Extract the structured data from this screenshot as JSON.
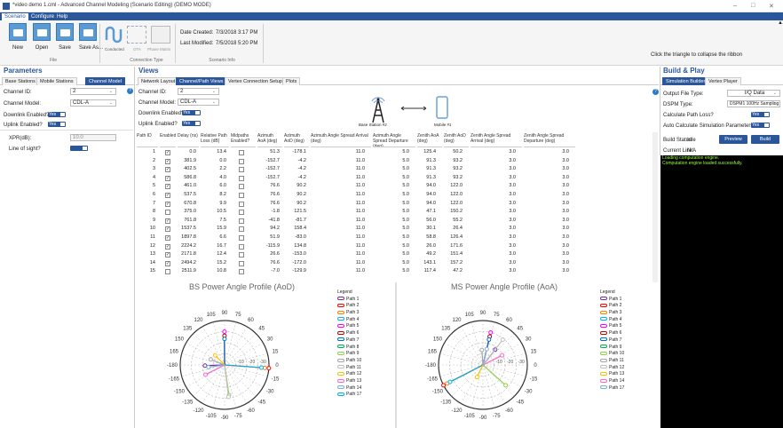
{
  "window": {
    "title": "*video demo 1.cml - Advanced Channel Modeling (Scenario Editing) (DEMO MODE)",
    "min": "–",
    "restore": "□",
    "close": "✕"
  },
  "menu": {
    "tabs": [
      "Scenario",
      "Configure",
      "Help"
    ]
  },
  "ribbon": {
    "file_buttons": [
      "New",
      "Open",
      "Save",
      "Save As..."
    ],
    "file_group": "File",
    "conn_buttons": [
      "Conducted",
      "OTA",
      "Phase Matrix"
    ],
    "conn_group": "Connection Type",
    "date_created_label": "Date Created:",
    "date_created": "7/3/2018 3:17 PM",
    "last_modified_label": "Last Modified:",
    "last_modified": "7/5/2018 5:20 PM",
    "scenario_group": "Scenario Info",
    "collapse_hint": "Click the triangle to collapse the ribbon"
  },
  "parameters": {
    "title": "Parameters",
    "tabs": [
      "Base Stations",
      "Mobile Stations",
      "Channel Model"
    ],
    "channel_id_label": "Channel ID:",
    "channel_id": "2",
    "channel_model_label": "Channel Model:",
    "channel_model": "CDL-A",
    "downlink_label": "Downlink Enabled?",
    "uplink_label": "Uplink Enabled?",
    "toggle_yes": "Yes",
    "xpr_label": "XPR(dB):",
    "xpr_value": "10.0",
    "los_label": "Line of sight?"
  },
  "views": {
    "title": "Views",
    "tabs": [
      "Network Layout",
      "Channel/Path Views",
      "Vertex Connection Setup",
      "Plots"
    ],
    "channel_id_label": "Channel ID:",
    "channel_id": "2",
    "channel_model_label": "Channel Model:",
    "channel_model": "CDL-A",
    "downlink_label": "Downlink Enabled?",
    "uplink_label": "Uplink Enabled?",
    "toggle_yes": "Yes",
    "base_station_label": "Base Station #2",
    "mobile_label": "Mobile #1"
  },
  "table": {
    "headers": [
      "Path ID",
      "Enabled?",
      "Delay (ns)",
      "Relative Path Loss (dB)",
      "Midpaths Enabled?",
      "Azimuth AoA (deg)",
      "Azimuth AoD (deg)",
      "Azimuth Angle Spread Arrival (deg)",
      "Azimuth Angle Spread Departure (deg)",
      "Zenith AoA (deg)",
      "Zenith AoD (deg)",
      "Zenith Angle Spread Arrival (deg)",
      "Zenith Angle Spread Departure (deg)"
    ],
    "rows": [
      [
        "1",
        true,
        "0.0",
        "13.4",
        false,
        "51.3",
        "-178.1",
        "11.0",
        "5.0",
        "125.4",
        "50.2",
        "3.0",
        "3.0"
      ],
      [
        "2",
        true,
        "381.9",
        "0.0",
        false,
        "-152.7",
        "-4.2",
        "11.0",
        "5.0",
        "91.3",
        "93.2",
        "3.0",
        "3.0"
      ],
      [
        "3",
        true,
        "402.5",
        "2.2",
        false,
        "-152.7",
        "-4.2",
        "11.0",
        "5.0",
        "91.3",
        "93.2",
        "3.0",
        "3.0"
      ],
      [
        "4",
        true,
        "586.8",
        "4.0",
        false,
        "-152.7",
        "-4.2",
        "11.0",
        "5.0",
        "91.3",
        "93.2",
        "3.0",
        "3.0"
      ],
      [
        "5",
        true,
        "461.0",
        "6.0",
        false,
        "76.6",
        "90.2",
        "11.0",
        "5.0",
        "94.0",
        "122.0",
        "3.0",
        "3.0"
      ],
      [
        "6",
        true,
        "537.5",
        "8.2",
        false,
        "76.6",
        "90.2",
        "11.0",
        "5.0",
        "94.0",
        "122.0",
        "3.0",
        "3.0"
      ],
      [
        "7",
        true,
        "670.8",
        "9.9",
        false,
        "76.6",
        "90.2",
        "11.0",
        "5.0",
        "94.0",
        "122.0",
        "3.0",
        "3.0"
      ],
      [
        "8",
        false,
        "375.0",
        "10.5",
        false,
        "-1.8",
        "121.5",
        "11.0",
        "5.0",
        "47.1",
        "150.2",
        "3.0",
        "3.0"
      ],
      [
        "9",
        true,
        "761.8",
        "7.5",
        false,
        "-41.8",
        "-81.7",
        "11.0",
        "5.0",
        "56.0",
        "55.2",
        "3.0",
        "3.0"
      ],
      [
        "10",
        true,
        "1537.5",
        "15.9",
        false,
        "94.2",
        "158.4",
        "11.0",
        "5.0",
        "30.1",
        "26.4",
        "3.0",
        "3.0"
      ],
      [
        "11",
        true,
        "1897.8",
        "6.6",
        false,
        "51.9",
        "-83.0",
        "11.0",
        "5.0",
        "58.8",
        "126.4",
        "3.0",
        "3.0"
      ],
      [
        "12",
        true,
        "2224.2",
        "16.7",
        false,
        "-115.9",
        "134.8",
        "11.0",
        "5.0",
        "26.0",
        "171.6",
        "3.0",
        "3.0"
      ],
      [
        "13",
        true,
        "2171.8",
        "12.4",
        false,
        "26.6",
        "-153.0",
        "11.0",
        "5.0",
        "49.2",
        "151.4",
        "3.0",
        "3.0"
      ],
      [
        "14",
        true,
        "2494.2",
        "15.2",
        false,
        "76.6",
        "-172.0",
        "11.0",
        "5.0",
        "143.1",
        "157.2",
        "3.0",
        "3.0"
      ],
      [
        "15",
        false,
        "2511.9",
        "10.8",
        false,
        "-7.0",
        "-129.9",
        "11.0",
        "5.0",
        "117.4",
        "47.2",
        "3.0",
        "3.0"
      ]
    ]
  },
  "bs_plot": {
    "title": "BS Power Angle Profile (AoD)"
  },
  "ms_plot": {
    "title": "MS Power Angle Profile (AoA)"
  },
  "polar_ticks": [
    "90",
    "75",
    "60",
    "45",
    "30",
    "15",
    "0",
    "-15",
    "-30",
    "-45",
    "-60",
    "-75",
    "-90",
    "-105",
    "-120",
    "-135",
    "-150",
    "-165",
    "-180",
    "165",
    "150",
    "135",
    "120",
    "105"
  ],
  "radial_ticks": [
    "-10",
    "-20",
    "-30"
  ],
  "legend": {
    "title": "Legend",
    "items": [
      "Path 1",
      "Path 2",
      "Path 3",
      "Path 4",
      "Path 5",
      "Path 6",
      "Path 7",
      "Path 8",
      "Path 9",
      "Path 10",
      "Path 11",
      "Path 12",
      "Path 13",
      "Path 14",
      "Path 17"
    ],
    "ms_items": [
      "Path 1",
      "Path 2",
      "Path 3",
      "Path 4",
      "Path 5",
      "Path 6",
      "Path 7",
      "Path 9",
      "Path 10",
      "Path 11",
      "Path 12",
      "Path 13",
      "Path 14",
      "Path 17"
    ]
  },
  "colors": [
    "#7030a0",
    "#ff0000",
    "#ff7f00",
    "#00b0f0",
    "#ff00ff",
    "#c00000",
    "#0070c0",
    "#00b050",
    "#92d050",
    "#a6a6a6",
    "#bfbfbf",
    "#ffc000",
    "#ff66cc",
    "#7fb3d5",
    "#00b0f0"
  ],
  "build": {
    "title": "Build & Play",
    "tabs": [
      "Simulation Builder",
      "Vertex Player"
    ],
    "output_type_label": "Output File Type:",
    "output_type": "I/Q Data",
    "dspm_label": "DSPM Type:",
    "dspm": "DSPM1 100Hz Sampling",
    "calc_loss_label": "Calculate Path Loss?",
    "auto_calc_label": "Auto Calculate Simulation Parameters?",
    "toggle_yes": "Yes",
    "status_label": "Build Status:",
    "status": "Idle",
    "preview": "Preview",
    "build": "Build",
    "link_label": "Current Link:",
    "link": "N/A",
    "console": [
      "Loading computation engine.",
      "Computation engine loaded successfully."
    ]
  }
}
